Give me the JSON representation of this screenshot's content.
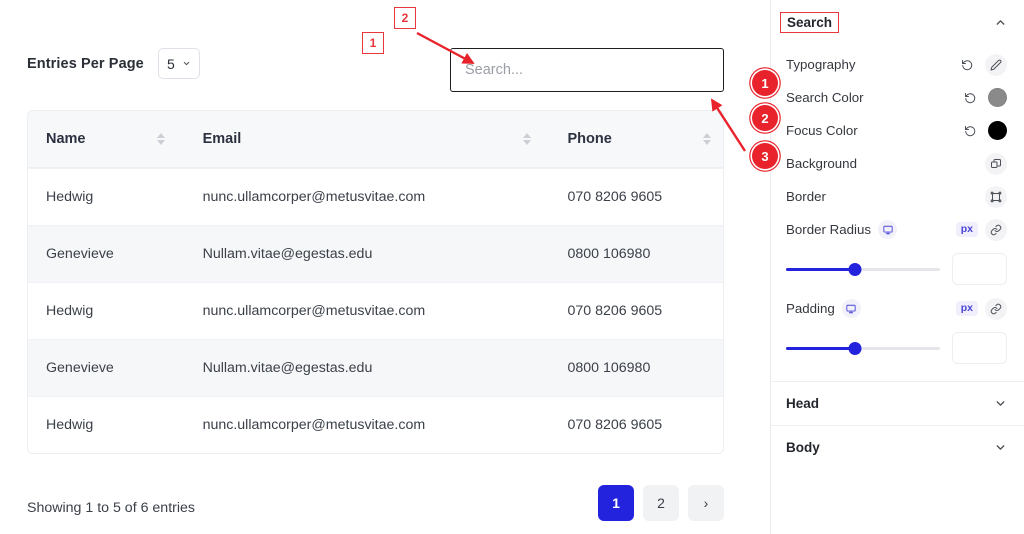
{
  "main": {
    "entries_per_page_label": "Entries Per Page",
    "entries_per_page_value": "5",
    "search_placeholder": "Search...",
    "search_value": "",
    "table": {
      "columns": [
        "Name",
        "Email",
        "Phone"
      ],
      "rows": [
        {
          "name": "Hedwig",
          "email": "nunc.ullamcorper@metusvitae.com",
          "phone": "070 8206 9605"
        },
        {
          "name": "Genevieve",
          "email": "Nullam.vitae@egestas.edu",
          "phone": "0800 106980"
        },
        {
          "name": "Hedwig",
          "email": "nunc.ullamcorper@metusvitae.com",
          "phone": "070 8206 9605"
        },
        {
          "name": "Genevieve",
          "email": "Nullam.vitae@egestas.edu",
          "phone": "0800 106980"
        },
        {
          "name": "Hedwig",
          "email": "nunc.ullamcorper@metusvitae.com",
          "phone": "070 8206 9605"
        }
      ]
    },
    "footer_text": "Showing 1 to 5 of 6 entries",
    "pagination": {
      "pages": [
        "1",
        "2"
      ],
      "active_page": "1",
      "next_label": "›"
    }
  },
  "sidebar": {
    "section_title": "Search",
    "collapse_icon": "chevron-up-icon",
    "rows": [
      {
        "label": "Typography",
        "controls": [
          "reset-icon",
          "edit-icon"
        ]
      },
      {
        "label": "Search Color",
        "controls": [
          "reset-icon",
          "color-swatch"
        ],
        "swatch": "#8a8a8a"
      },
      {
        "label": "Focus Color",
        "controls": [
          "reset-icon",
          "color-swatch"
        ],
        "swatch": "#000000"
      },
      {
        "label": "Background",
        "controls": [
          "layers-icon"
        ]
      },
      {
        "label": "Border",
        "controls": [
          "border-icon"
        ]
      }
    ],
    "border_radius": {
      "label": "Border Radius",
      "device_icon": "desktop-icon",
      "unit": "px",
      "link_icon": "link-icon",
      "slider_percent": 45,
      "value": ""
    },
    "padding": {
      "label": "Padding",
      "device_icon": "desktop-icon",
      "unit": "px",
      "link_icon": "link-icon",
      "slider_percent": 45,
      "value": ""
    },
    "collapsed_sections": [
      {
        "label": "Head",
        "icon": "chevron-down-icon"
      },
      {
        "label": "Body",
        "icon": "chevron-down-icon"
      }
    ]
  },
  "annotations": {
    "markers": [
      "1",
      "2"
    ],
    "badges": [
      "1",
      "2",
      "3"
    ],
    "accent_color": "#e8232c"
  }
}
